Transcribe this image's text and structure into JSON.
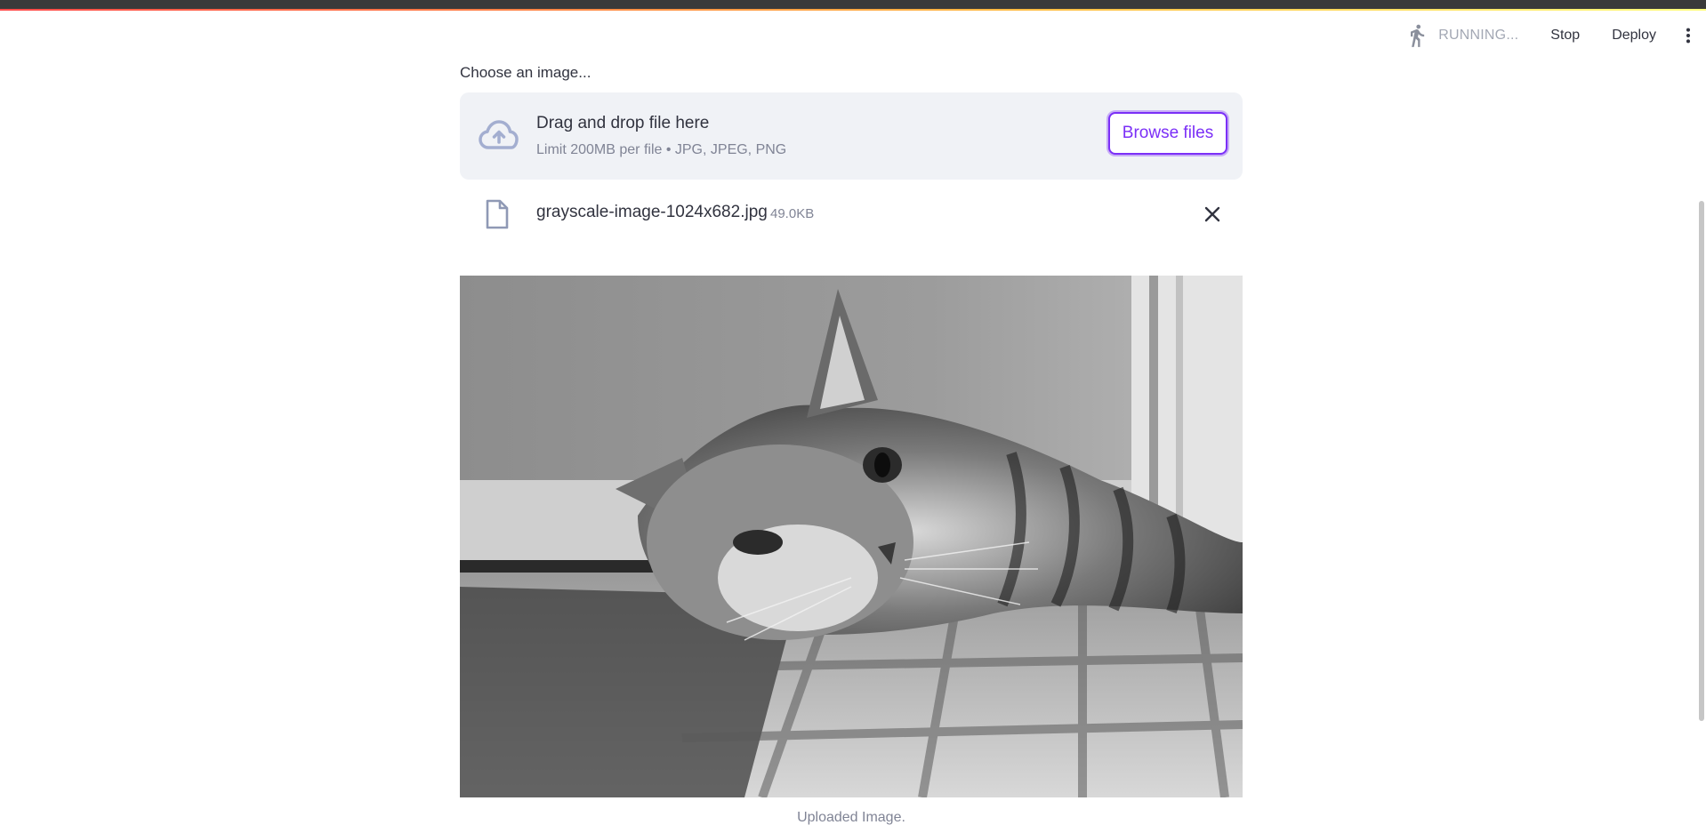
{
  "header": {
    "status_text": "RUNNING...",
    "stop_label": "Stop",
    "deploy_label": "Deploy",
    "status_icon": "running-person-icon",
    "menu_icon": "more-vertical-icon"
  },
  "uploader": {
    "label": "Choose an image...",
    "dropzone_title": "Drag and drop file here",
    "dropzone_subtitle": "Limit 200MB per file • JPG, JPEG, PNG",
    "browse_label": "Browse files",
    "upload_icon": "cloud-upload-icon"
  },
  "uploaded_file": {
    "name": "grayscale-image-1024x682.jpg",
    "size": "49.0KB",
    "file_icon": "file-icon",
    "remove_icon": "close-icon"
  },
  "image": {
    "caption": "Uploaded Image."
  },
  "colors": {
    "accent": "#7b2ff7",
    "dropzone_bg": "#f0f2f6",
    "muted_text": "#808495",
    "text": "#31333f"
  }
}
